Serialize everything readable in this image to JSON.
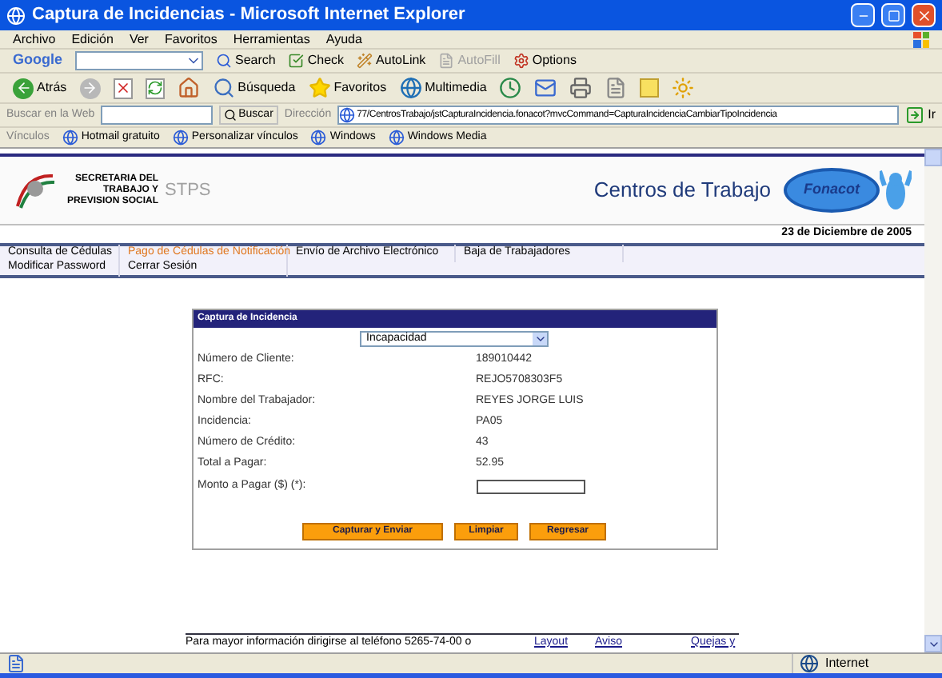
{
  "window": {
    "title": "Captura de Incidencias - Microsoft Internet Explorer"
  },
  "menu": [
    "Archivo",
    "Edición",
    "Ver",
    "Favoritos",
    "Herramientas",
    "Ayuda"
  ],
  "google_toolbar": {
    "logo": "Google",
    "items": [
      {
        "kind": "search",
        "label": "Search",
        "disabled": false
      },
      {
        "kind": "check",
        "label": "Check",
        "disabled": false
      },
      {
        "kind": "autolink",
        "label": "AutoLink",
        "disabled": false
      },
      {
        "kind": "autofill",
        "label": "AutoFill",
        "disabled": true
      },
      {
        "kind": "options",
        "label": "Options",
        "disabled": false
      }
    ]
  },
  "nav_toolbar": {
    "back": "Atrás",
    "items": [
      {
        "kind": "search",
        "label": "Búsqueda"
      },
      {
        "kind": "favorites",
        "label": "Favoritos"
      },
      {
        "kind": "media",
        "label": "Multimedia"
      }
    ]
  },
  "search_bar": {
    "label": "Buscar en la Web",
    "button": "Buscar"
  },
  "address": {
    "label": "Dirección",
    "value": "77/CentrosTrabajo/jstCapturaIncidencia.fonacot?mvcCommand=CapturaIncidenciaCambiarTipoIncidencia",
    "go": "Ir"
  },
  "links": {
    "label": "Vínculos",
    "items": [
      "Hotmail gratuito",
      "Personalizar vínculos",
      "Windows",
      "Windows Media"
    ]
  },
  "header": {
    "logo_lines": [
      "SECRETARIA DEL",
      "TRABAJO Y",
      "PREVISION SOCIAL"
    ],
    "logo_abbr": "STPS",
    "title": "Centros de Trabajo",
    "brand": "Fonacot"
  },
  "date": "23 de Diciembre de 2005",
  "nav_menu": [
    {
      "items": [
        {
          "label": "Consulta de Cédulas",
          "selected": false
        },
        {
          "label": "Pago de Cédulas de Notificación",
          "selected": true
        },
        {
          "label": "Envío de Archivo Electrónico",
          "selected": false
        },
        {
          "label": "Baja de Trabajadores",
          "selected": false
        }
      ]
    },
    {
      "items": [
        {
          "label": "Modificar Password",
          "selected": false
        },
        {
          "label": "Cerrar Sesión",
          "selected": false
        }
      ]
    }
  ],
  "form": {
    "title": "Captura de Incidencia",
    "type_select": "Incapacidad",
    "fields": [
      {
        "label": "Número de Cliente:",
        "value": "189010442"
      },
      {
        "label": "RFC:",
        "value": "REJO5708303F5"
      },
      {
        "label": "Nombre del Trabajador:",
        "value": "REYES JORGE LUIS"
      },
      {
        "label": "Incidencia:",
        "value": "PA05"
      },
      {
        "label": "Número de Crédito:",
        "value": "43"
      },
      {
        "label": "Total a Pagar:",
        "value": "52.95"
      }
    ],
    "input_label": "Monto a Pagar ($) (*):",
    "buttons": [
      "Capturar y Enviar",
      "Limpiar",
      "Regresar"
    ]
  },
  "footer": {
    "text": "Para mayor información dirigirse al teléfono 5265-74-00 o",
    "links": [
      "Layout",
      "Aviso",
      "Quejas y"
    ]
  },
  "status_bar": {
    "zone": "Internet"
  }
}
